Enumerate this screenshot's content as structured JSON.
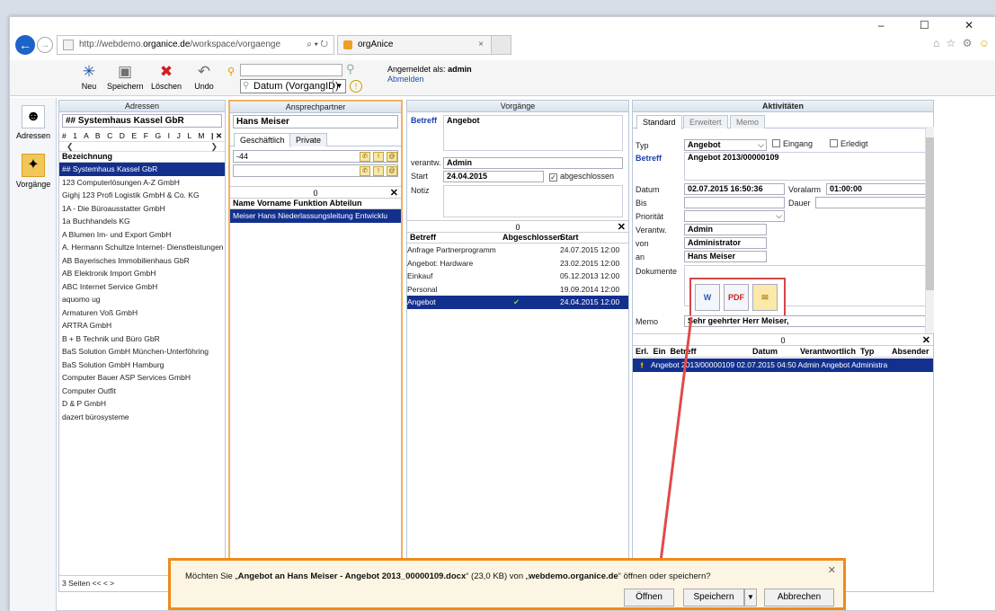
{
  "browser": {
    "url_prefix": "http://webdemo.",
    "url_host": "organice.de",
    "url_path": "/workspace/vorgaenge",
    "url_controls": "⌕ ▾ ↻",
    "tab_title": "orgAnice",
    "tab_close": "×",
    "window_controls": "– ☐ ✕",
    "right_icons": "⌂ ☆ ⚙"
  },
  "toolbar": {
    "buttons": [
      {
        "label": "Neu",
        "icon": "new-star-icon",
        "glyph": "✳"
      },
      {
        "label": "Speichern",
        "icon": "save-disk-icon",
        "glyph": "▣"
      },
      {
        "label": "Löschen",
        "icon": "delete-x-icon",
        "glyph": "✖"
      },
      {
        "label": "Undo",
        "icon": "undo-icon",
        "glyph": "↶"
      }
    ],
    "sort_value": "Datum (VorgangID)",
    "login_label": "Angemeldet als:",
    "login_user": "admin",
    "logout": "Abmelden"
  },
  "nav": [
    {
      "label": "Adressen",
      "icon": "addresses-icon",
      "glyph": "☻"
    },
    {
      "label": "Vorgänge",
      "icon": "processes-icon",
      "glyph": "✦"
    }
  ],
  "adressen": {
    "title": "Adressen",
    "current": "## Systemhaus Kassel GbR",
    "alphabet": "# 1 A B C D E F G I J L M",
    "col": "Bezeichnung",
    "rows": [
      "## Systemhaus Kassel GbR",
      "123 Computerlösungen A-Z GmbH",
      "Gighj 123 Profi Logistik GmbH & Co. KG",
      "1A - Die Büroausstatter GmbH",
      "1a Buchhandels KG",
      "A Blumen Im- und Export GmbH",
      "A. Hermann Schultze Internet- Dienstleistungen",
      "AB Bayerisches Immobilienhaus GbR",
      "AB Elektronik Import GmbH",
      "ABC Internet Service GmbH",
      "aquomo ug",
      "Armaturen Voß GmbH",
      "ARTRA GmbH",
      "B + B Technik und Büro GbR",
      "BaS Solution GmbH München-Unterföhring",
      "BaS Solution GmbH Hamburg",
      "Computer Bauer ASP Services GmbH",
      "Computer Outfit",
      "D & P GmbH",
      "dazert bürosysteme"
    ],
    "pages": "3 Seiten     <<    <    >"
  },
  "ansprech": {
    "title": "Ansprechpartner",
    "current": "Hans Meiser",
    "tab1": "Geschäftlich",
    "tab2": "Private",
    "phone": "-44",
    "count": "0",
    "cols": "Name  Vorname  Funktion                Abteilun",
    "row": "Meiser  Hans      Niederlassungsleitung  Entwicklu"
  },
  "vorgaenge": {
    "title": "Vorgänge",
    "betreff_label": "Betreff",
    "betreff": "Angebot",
    "verantw_label": "verantw.",
    "verantw": "Admin",
    "start_label": "Start",
    "start": "24.04.2015",
    "abgeschlossen": "abgeschlossen",
    "notiz_label": "Notiz",
    "count": "0",
    "cols": [
      "Betreff",
      "Abgeschlossen",
      "Start"
    ],
    "rows": [
      {
        "betreff": "Anfrage Partnerprogramm",
        "done": "",
        "start": "24.07.2015 12:00"
      },
      {
        "betreff": "Angebot: Hardware",
        "done": "",
        "start": "23.02.2015 12:00"
      },
      {
        "betreff": "Einkauf",
        "done": "",
        "start": "05.12.2013 12:00"
      },
      {
        "betreff": "Personal",
        "done": "",
        "start": "19.09.2014 12:00"
      },
      {
        "betreff": "Angebot",
        "done": "✔",
        "start": "24.04.2015 12:00"
      }
    ]
  },
  "aktiv": {
    "title": "Aktivitäten",
    "tabs": [
      "Standard",
      "Erweitert",
      "Memo"
    ],
    "typ_label": "Typ",
    "typ": "Angebot",
    "eingang": "Eingang",
    "erledigt": "Erledigt",
    "betreff_label": "Betreff",
    "betreff": "Angebot 2013/00000109",
    "datum_label": "Datum",
    "datum": "02.07.2015 16:50:36",
    "voralarm_label": "Voralarm",
    "voralarm": "01:00:00",
    "bis_label": "Bis",
    "dauer_label": "Dauer",
    "prio_label": "Priorität",
    "verantw_label": "Verantw.",
    "verantw": "Admin",
    "von_label": "von",
    "von": "Administrator",
    "an_label": "an",
    "an": "Hans Meiser",
    "dok_label": "Dokumente",
    "memo_label": "Memo",
    "memo": "Sehr geehrter Herr Meiser,",
    "count": "0",
    "cols": "Erl.  Ein  Betreff                         Datum          Verantwortlich  Typ        Absender",
    "row": "Angebot 2013/00000109  02.07.2015 04:50  Admin              Angebot  Administra"
  },
  "download": {
    "msg_pre": "Möchten Sie „",
    "file": "Angebot an Hans Meiser - Angebot 2013_00000109.docx",
    "msg_mid": "“ (23,0 KB) von „",
    "host": "webdemo.organice.de",
    "msg_post": "“ öffnen oder speichern?",
    "open": "Öffnen",
    "save": "Speichern",
    "cancel": "Abbrechen"
  },
  "colors": {
    "accent": "#f08a1a",
    "selection": "#14308e",
    "highlight": "#d64545"
  }
}
